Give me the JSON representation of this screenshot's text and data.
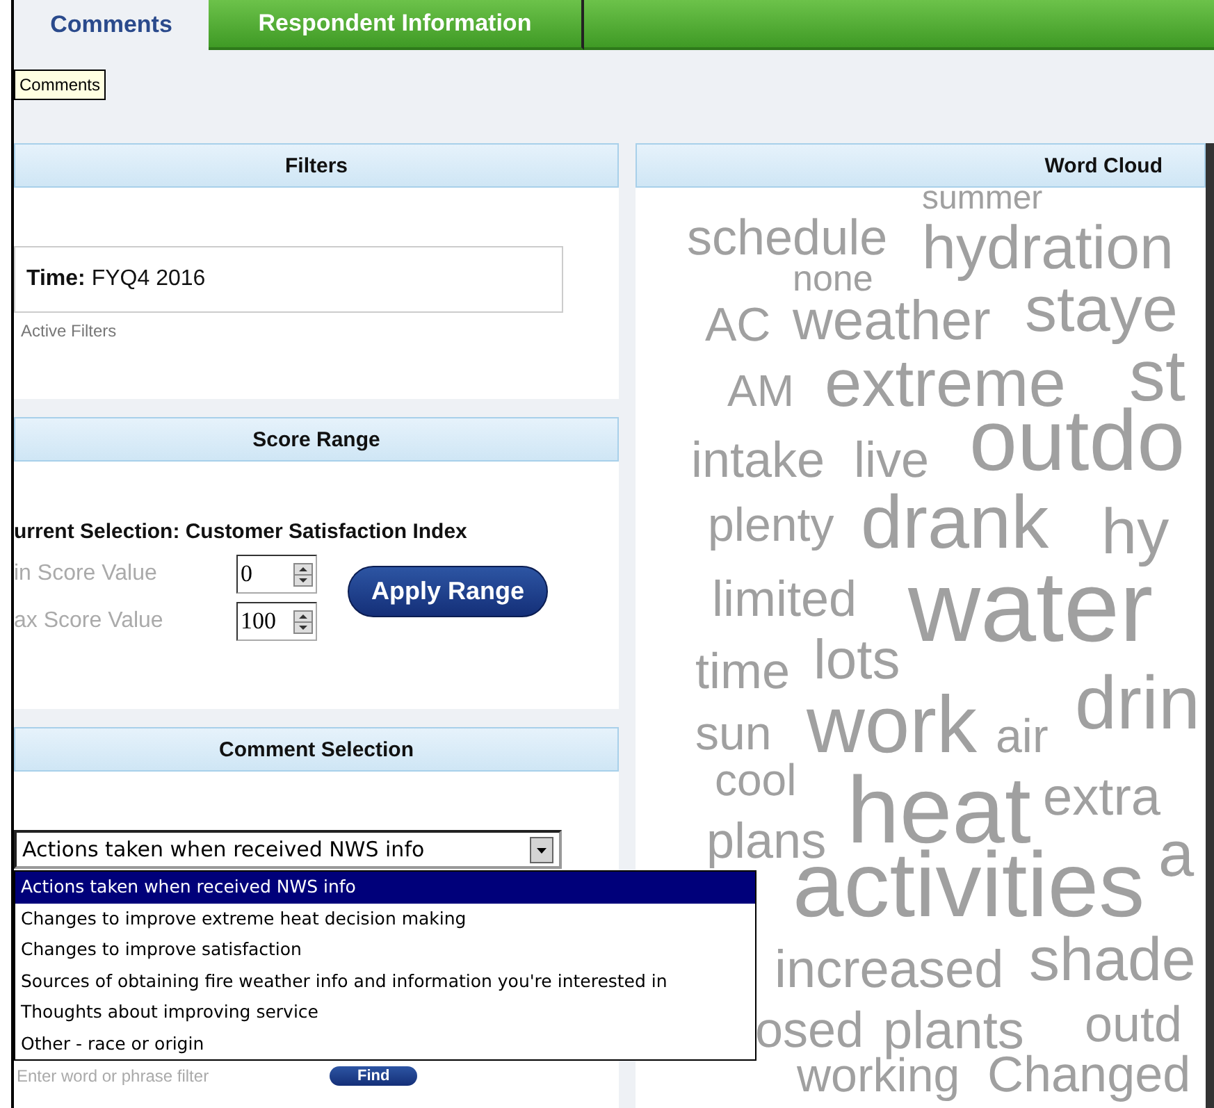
{
  "tabs": [
    {
      "label": "Comments",
      "selected": true
    },
    {
      "label": "Respondent Information",
      "selected": false
    }
  ],
  "tooltip": "Comments",
  "filters": {
    "title": "Filters",
    "label": "Time:",
    "value": "FYQ4 2016",
    "note": "Active Filters"
  },
  "score_range": {
    "title": "Score Range",
    "current_selection": "urrent Selection: Customer Satisfaction Index",
    "fields": [
      {
        "label": "in Score Value",
        "value": "0"
      },
      {
        "label": "ax Score Value",
        "value": "100"
      }
    ],
    "button": "Apply Range"
  },
  "comment_selection": {
    "title": "Comment Selection",
    "select_value": "Actions taken when received NWS info",
    "options": [
      {
        "label": "Actions taken when received NWS info",
        "selected": true
      },
      {
        "label": "Changes to improve extreme heat decision making",
        "selected": false
      },
      {
        "label": "Changes to improve satisfaction",
        "selected": false
      },
      {
        "label": "Sources of obtaining fire weather info and information you're interested in",
        "selected": false
      },
      {
        "label": "Thoughts about improving service",
        "selected": false
      },
      {
        "label": "Other - race or origin",
        "selected": false
      }
    ],
    "search": {
      "placeholder": "Enter word or phrase filter"
    },
    "find_button": "Find"
  },
  "word_cloud": {
    "title": "Word Cloud",
    "words": [
      "summer",
      "schedule",
      "hydration",
      "none",
      "AC",
      "weather",
      "staye",
      "AM",
      "extreme",
      "st",
      "intake",
      "live",
      "outdo",
      "plenty",
      "drank",
      "hy",
      "limited",
      "water",
      "time",
      "lots",
      "sun",
      "work",
      "air",
      "drin",
      "cool",
      "heat",
      "extra",
      "plans",
      "activities",
      "a",
      "increased",
      "shade",
      "osed",
      "plants",
      "outd",
      "working",
      "Changed"
    ]
  }
}
